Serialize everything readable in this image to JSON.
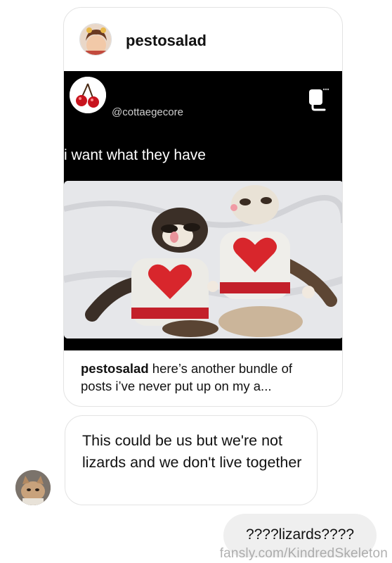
{
  "shared_post": {
    "sender_name": "pestosalad",
    "embed": {
      "handle": "@cottaegecore",
      "caption": "i want what they have"
    },
    "footer": {
      "name": "pestosalad",
      "text": " here’s another bundle of posts i’ve never put up on my a..."
    }
  },
  "messages": {
    "incoming": "This could be us but we're not lizards and we don't live together",
    "outgoing": "????lizards????"
  },
  "watermark": "fansly.com/KindredSkeleton",
  "icons": {
    "copy": "copy-icon",
    "cherry": "cherry-icon"
  },
  "colors": {
    "embed_background": "#000000",
    "outgoing_bubble": "#efefef",
    "heart_sweater": "#d8262c"
  }
}
